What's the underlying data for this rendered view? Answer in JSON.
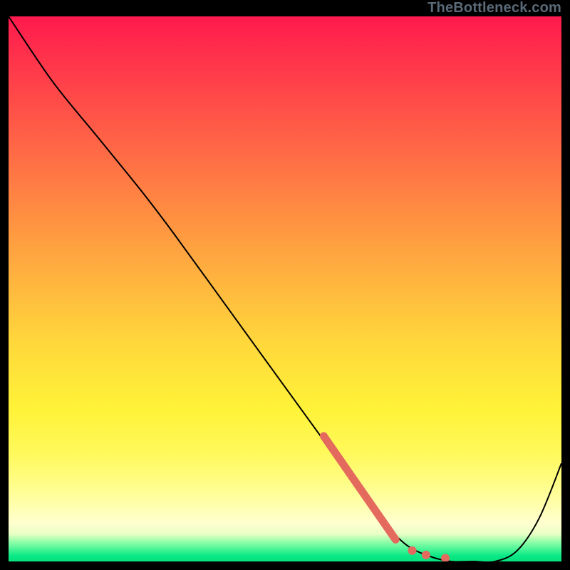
{
  "attribution_text": "TheBottleneck.com",
  "colors": {
    "curve_stroke": "#000000",
    "highlight_stroke": "#e46a5e",
    "bg_black": "#000000"
  },
  "chart_data": {
    "type": "line",
    "title": "",
    "xlabel": "",
    "ylabel": "",
    "xlim": [
      0,
      100
    ],
    "ylim": [
      0,
      100
    ],
    "series": [
      {
        "name": "bottleneck-curve",
        "x": [
          0,
          8,
          16,
          24,
          30,
          40,
          50,
          60,
          64,
          68,
          72,
          76,
          80,
          84,
          88,
          92,
          96,
          100
        ],
        "y": [
          100,
          88,
          78,
          68,
          60,
          46,
          32,
          18,
          12,
          7,
          3,
          1,
          0,
          0,
          0,
          2,
          8,
          18
        ]
      }
    ],
    "highlight": {
      "segment": {
        "x": [
          57,
          70
        ],
        "y": [
          23,
          4
        ]
      },
      "dots": [
        {
          "x": 73,
          "y": 2
        },
        {
          "x": 75.5,
          "y": 1.2
        },
        {
          "x": 79,
          "y": 0.6
        }
      ]
    },
    "annotations": [
      {
        "text": "TheBottleneck.com",
        "position": "top-right"
      }
    ]
  }
}
